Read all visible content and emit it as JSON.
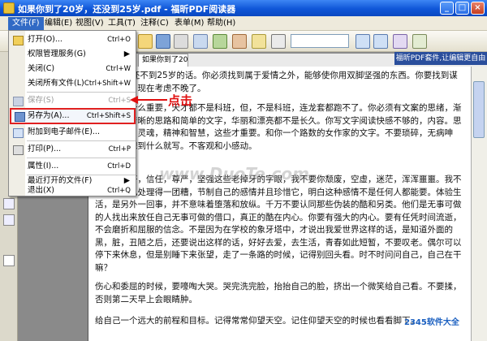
{
  "title_bar": {
    "title": "如果你到了20岁，还没到25岁.pdf - 福昕PDF阅读器"
  },
  "menubar": [
    {
      "label": "文件(F)"
    },
    {
      "label": "编辑(E)"
    },
    {
      "label": "视图(V)"
    },
    {
      "label": "工具(T)"
    },
    {
      "label": "注释(C)"
    },
    {
      "label": "表单(M)"
    },
    {
      "label": "帮助(H)"
    }
  ],
  "search": {
    "value": ""
  },
  "doc_tab": {
    "label": "如果你到了20岁，还没..."
  },
  "promo_banner": {
    "text": "福昕PDF套件,让编辑更自由"
  },
  "file_menu": {
    "items": [
      {
        "label": "打开(O)...",
        "shortcut": "Ctrl+O"
      },
      {
        "label": "权限管理服务(G)"
      },
      {
        "label": "关闭(C)",
        "shortcut": "Ctrl+W"
      },
      {
        "label": "关闭所有文件(L)",
        "shortcut": "Ctrl+Shift+W"
      },
      {
        "label": "保存(S)",
        "shortcut": "Ctrl+S"
      },
      {
        "label": "另存为(A)...",
        "shortcut": "Ctrl+Shift+S"
      },
      {
        "label": "附加到电子邮件(E)..."
      },
      {
        "label": "打印(P)...",
        "shortcut": "Ctrl+P"
      },
      {
        "label": "属性(I)...",
        "shortcut": "Ctrl+D"
      },
      {
        "label": "最近打开的文件(F)"
      },
      {
        "label": "退出(X)",
        "shortcut": "Ctrl+Q"
      }
    ]
  },
  "annotation": {
    "text": "点击"
  },
  "document": {
    "paragraphs": [
      "了20岁但还不到25岁的话。你必须找到属于爱情之外，能够使你用双脚坚强的东西。你要找到谋生的方式。现在考虑不晚了。",
      "大学历有什么重要，天才都不是科班，但，不是科班，连龙套都跑不了。你必须有文案的思绪，渐渐转化为清晰的思路和简单的文字，华丽和漂亮都不是长久。你写文字阅读快感不够的，内容。思想，境界，灵魂，精神和智慧，这些才重要。和你一个路数的女作家的文字。不要琐碎，无病呻吟。不要想到什么就写。不客观和小感动。",
      "暧昧。美好，信任，尊严，坚强这些老掉牙的字眼，我不要你颓废，空虚，迷茫，浑浑噩噩。我不要你把自己处理得一团糟，节制自己的感情并且珍惜它，明白这种感情不是任何人都能要。体验生活，是另外一回事，并不意味着堕落和放纵。千万不要认同那些伪装的酷和另类。他们是无事可做的人找出来放任自己无事可做的借口，真正的酷在内心。你要有强大的内心。要有任凭时间流逝，不会磨折和屈服的信念。不是因为在学校的象牙塔中，才说出我爱世界这样的话，是知道外面的黑，脏，丑陋之后，还要说出这样的话，好好去爱，去生活，青春如此短暂，不要叹老。偶尔可以停下来休息，但是别睡下来张望，走了一条路的时候，记得别回头看。时不时问问自己，自己在干嘛？",
      "伤心和委屈的时候，要嚎啕大哭。哭完洗完脸，抬抬自己的脸，挤出一个微笑给自己看。不要揉，否则第二天早上会眼睛肿。",
      "给自己一个远大的前程和目标。记得常常仰望天空。记住仰望天空的时候也看看脚下。"
    ]
  },
  "watermark": {
    "text": "www.DuoTe.com"
  },
  "brand_logo": {
    "text": "2345软件大全"
  }
}
